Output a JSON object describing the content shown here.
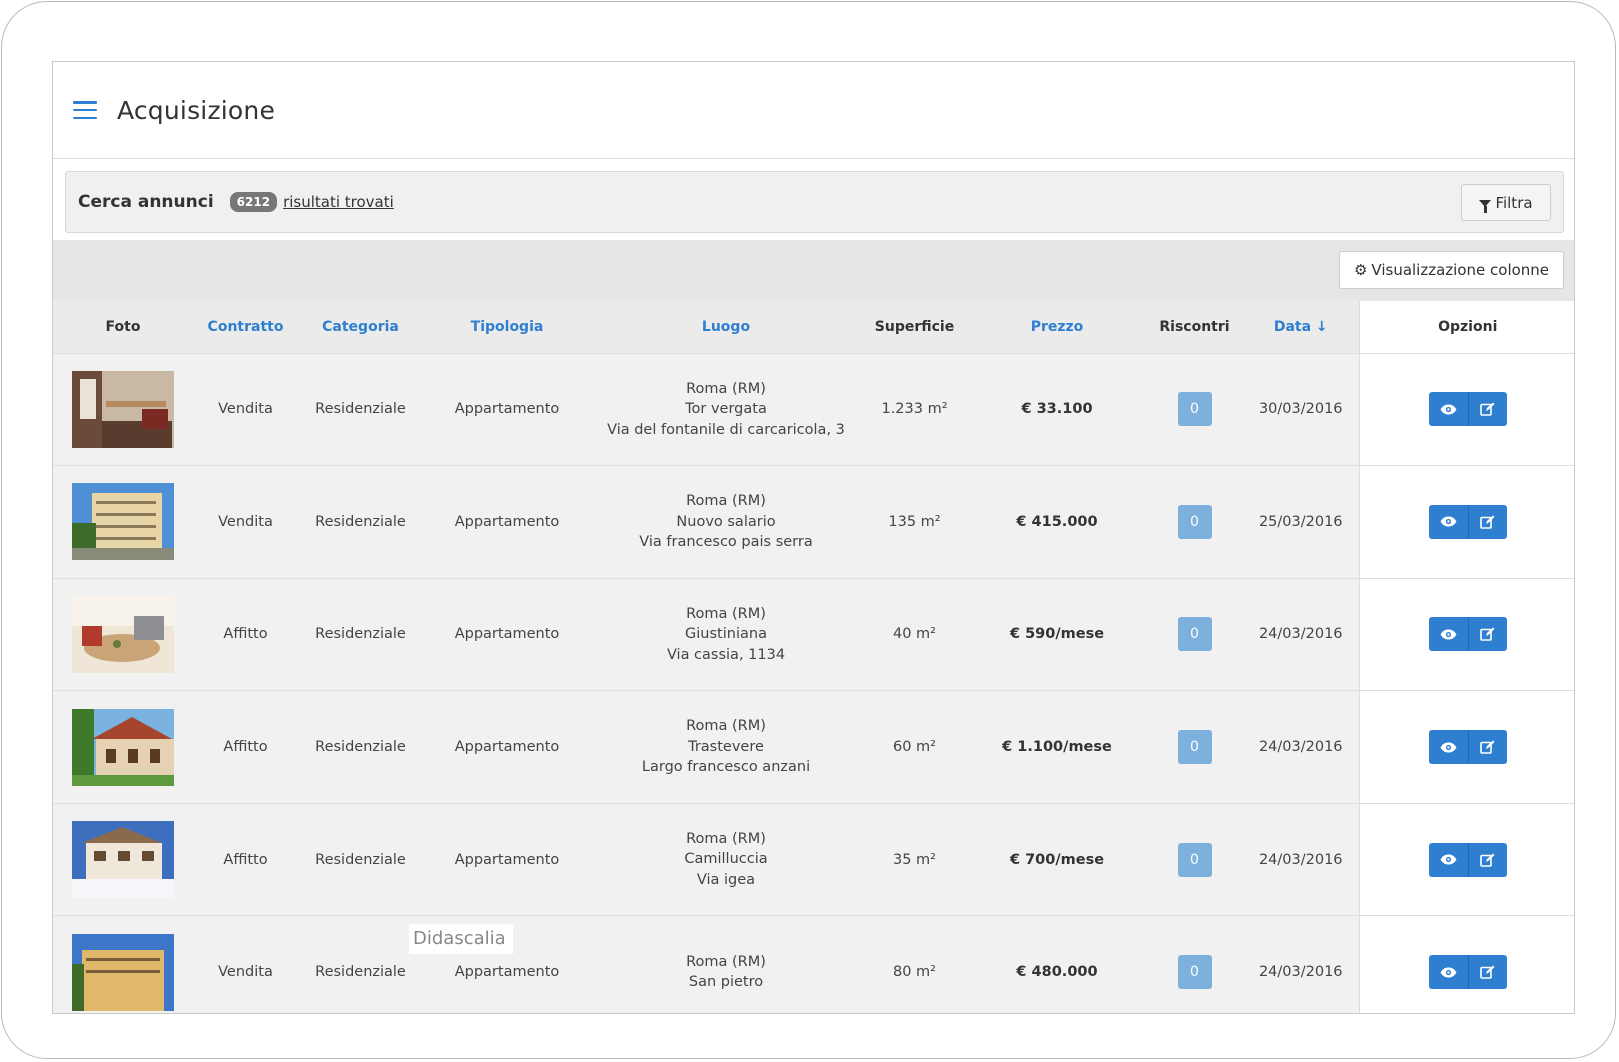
{
  "header": {
    "title": "Acquisizione"
  },
  "search": {
    "title": "Cerca annunci",
    "count": "6212",
    "results_text": "risultati trovati",
    "filter_label": "Filtra"
  },
  "toolbar": {
    "columns_label": "Visualizzazione colonne"
  },
  "table": {
    "headers": {
      "foto": "Foto",
      "contratto": "Contratto",
      "categoria": "Categoria",
      "tipologia": "Tipologia",
      "luogo": "Luogo",
      "superficie": "Superficie",
      "prezzo": "Prezzo",
      "riscontri": "Riscontri",
      "data": "Data",
      "opzioni": "Opzioni"
    },
    "sorted_column": "data",
    "rows": [
      {
        "contratto": "Vendita",
        "categoria": "Residenziale",
        "tipologia": "Appartamento",
        "luogo1": "Roma (RM)",
        "luogo2": "Tor vergata",
        "luogo3": "Via del fontanile di carcaricola, 3",
        "superficie": "1.233 m²",
        "prezzo": "€ 33.100",
        "riscontri": "0",
        "data": "30/03/2016"
      },
      {
        "contratto": "Vendita",
        "categoria": "Residenziale",
        "tipologia": "Appartamento",
        "luogo1": "Roma (RM)",
        "luogo2": "Nuovo salario",
        "luogo3": "Via francesco pais serra",
        "superficie": "135 m²",
        "prezzo": "€ 415.000",
        "riscontri": "0",
        "data": "25/03/2016"
      },
      {
        "contratto": "Affitto",
        "categoria": "Residenziale",
        "tipologia": "Appartamento",
        "luogo1": "Roma (RM)",
        "luogo2": "Giustiniana",
        "luogo3": "Via cassia, 1134",
        "superficie": "40 m²",
        "prezzo": "€ 590/mese",
        "riscontri": "0",
        "data": "24/03/2016"
      },
      {
        "contratto": "Affitto",
        "categoria": "Residenziale",
        "tipologia": "Appartamento",
        "luogo1": "Roma (RM)",
        "luogo2": "Trastevere",
        "luogo3": "Largo francesco anzani",
        "superficie": "60 m²",
        "prezzo": "€ 1.100/mese",
        "riscontri": "0",
        "data": "24/03/2016"
      },
      {
        "contratto": "Affitto",
        "categoria": "Residenziale",
        "tipologia": "Appartamento",
        "luogo1": "Roma (RM)",
        "luogo2": "Camilluccia",
        "luogo3": "Via igea",
        "superficie": "35 m²",
        "prezzo": "€ 700/mese",
        "riscontri": "0",
        "data": "24/03/2016"
      },
      {
        "contratto": "Vendita",
        "categoria": "Residenziale",
        "tipologia": "Appartamento",
        "luogo1": "Roma (RM)",
        "luogo2": "San pietro",
        "luogo3": "",
        "superficie": "80 m²",
        "prezzo": "€ 480.000",
        "riscontri": "0",
        "data": "24/03/2016"
      }
    ]
  },
  "caption": "Didascalia",
  "colors": {
    "accent": "#2f7fd0",
    "counter": "#7eb0de"
  },
  "icons": [
    "menu-icon",
    "filter-icon",
    "gear-icon",
    "sort-down-icon",
    "eye-icon",
    "edit-icon"
  ]
}
